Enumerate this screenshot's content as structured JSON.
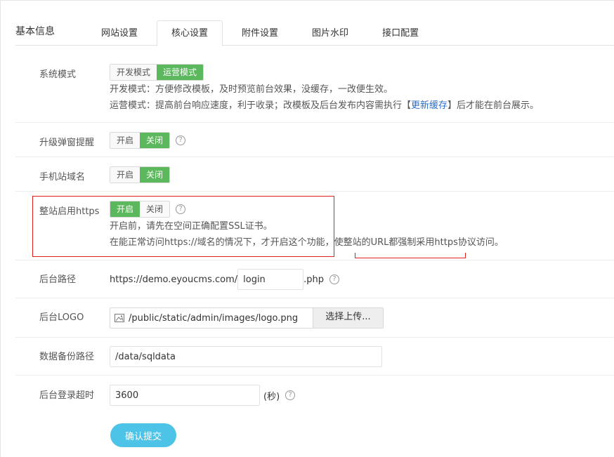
{
  "header": {
    "section_title": "基本信息",
    "tabs": [
      {
        "label": "网站设置",
        "active": false
      },
      {
        "label": "核心设置",
        "active": true
      },
      {
        "label": "附件设置",
        "active": false
      },
      {
        "label": "图片水印",
        "active": false
      },
      {
        "label": "接口配置",
        "active": false
      }
    ]
  },
  "system_mode": {
    "label": "系统模式",
    "dev_label": "开发模式",
    "ops_label": "运营模式",
    "selected": "运营模式",
    "note_dev": "开发模式：方便修改模板，及时预览前台效果，没缓存，一改便生效。",
    "note_ops_prefix": "运营模式：提高前台响应速度，利于收录；改模板及后台发布内容需执行【",
    "note_ops_link": "更新缓存",
    "note_ops_suffix": "】后才能在前台展示。"
  },
  "upgrade_popup": {
    "label": "升级弹窗提醒",
    "on_label": "开启",
    "off_label": "关闭",
    "selected": "关闭"
  },
  "mobile_domain": {
    "label": "手机站域名",
    "on_label": "开启",
    "off_label": "关闭",
    "selected": "关闭"
  },
  "https": {
    "label": "整站启用https",
    "on_label": "开启",
    "off_label": "关闭",
    "selected": "开启",
    "note_1": "开启前，请先在空间正确配置SSL证书。",
    "note_2": "在能正常访问https://域名的情况下，才开启这个功能，使整站的URL都强制采用https协议访问。"
  },
  "admin_path": {
    "label": "后台路径",
    "prefix": "https://demo.eyoucms.com/",
    "value": "login",
    "suffix": ".php"
  },
  "admin_logo": {
    "label": "后台LOGO",
    "path": "/public/static/admin/images/logo.png",
    "upload_label": "选择上传..."
  },
  "backup_path": {
    "label": "数据备份路径",
    "value": "/data/sqldata"
  },
  "login_timeout": {
    "label": "后台登录超时",
    "value": "3600",
    "unit": "(秒)"
  },
  "submit": {
    "label": "确认提交"
  },
  "colors": {
    "toggle_on": "#5cb85c",
    "submit_bg": "#4dc3e8",
    "link": "#2a6fc9",
    "highlight": "#e02020"
  }
}
